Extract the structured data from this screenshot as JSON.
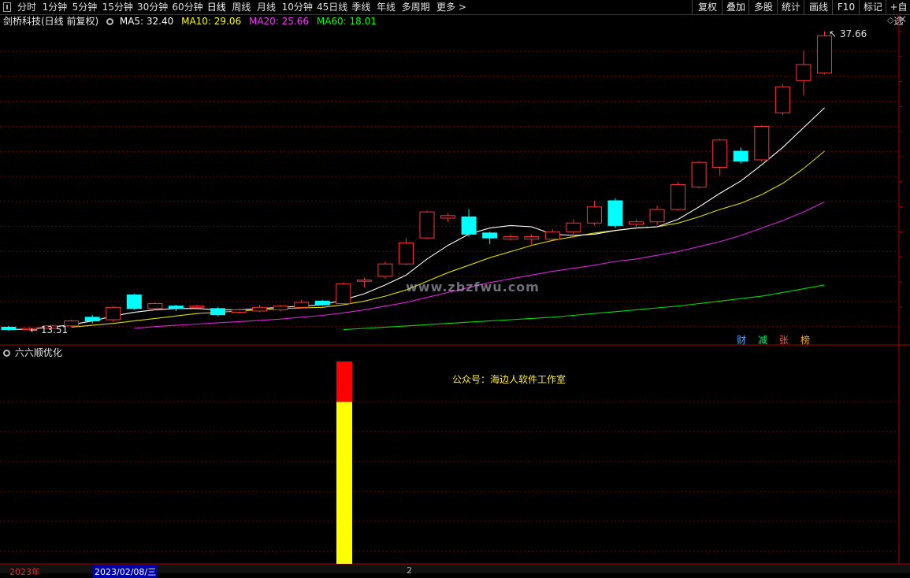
{
  "toolbar": {
    "periods": [
      "分时",
      "1分钟",
      "5分钟",
      "15分钟",
      "30分钟",
      "60分钟",
      "日线",
      "周线",
      "月线",
      "10分钟",
      "45日线",
      "季线",
      "年线",
      "多周期",
      "更多 >"
    ],
    "active_period": "日线",
    "right_buttons": [
      "复权",
      "叠加",
      "多股",
      "统计",
      "画线",
      "F10",
      "标记",
      "+自选"
    ]
  },
  "main_chart": {
    "stock_name": "剑桥科技(日线 前复权)",
    "ma": [
      {
        "label": "MA5: 32.40",
        "color": "#ffffff"
      },
      {
        "label": "MA10: 29.06",
        "color": "#ffff00"
      },
      {
        "label": "MA20: 25.66",
        "color": "#ff33ff"
      },
      {
        "label": "MA60: 18.01",
        "color": "#00ff00"
      }
    ],
    "high_label": "37.66",
    "low_label": "13.51",
    "watermark": "www.zbzfwu.com",
    "right_axis_label": "37",
    "badges": [
      {
        "text": "财",
        "color": "#55aaff"
      },
      {
        "text": "减",
        "color": "#00ff66"
      },
      {
        "text": "张",
        "color": "#ff5555"
      },
      {
        "text": "榜",
        "color": "#ffaa33"
      }
    ]
  },
  "indicator": {
    "name": "六六顺优化",
    "note": "公众号：海边人软件工作室",
    "bar": {
      "red_fraction": 0.2
    }
  },
  "footer": {
    "year_label": "2023年",
    "date_label": "2023/02/08/三",
    "marker": "2"
  },
  "chart_data": {
    "type": "candlestick",
    "price_range": [
      13.51,
      37.66
    ],
    "candles": [
      {
        "o": 13.8,
        "c": 13.6,
        "h": 13.9,
        "l": 13.5
      },
      {
        "o": 13.6,
        "c": 13.7,
        "h": 13.8,
        "l": 13.5
      },
      {
        "o": 13.7,
        "c": 13.9,
        "h": 14.0,
        "l": 13.6
      },
      {
        "o": 13.9,
        "c": 14.3,
        "h": 14.4,
        "l": 13.8
      },
      {
        "o": 14.6,
        "c": 14.3,
        "h": 14.8,
        "l": 14.1
      },
      {
        "o": 14.4,
        "c": 15.4,
        "h": 15.5,
        "l": 14.2
      },
      {
        "o": 16.4,
        "c": 15.3,
        "h": 16.5,
        "l": 15.2
      },
      {
        "o": 15.3,
        "c": 15.7,
        "h": 15.8,
        "l": 15.2
      },
      {
        "o": 15.5,
        "c": 15.3,
        "h": 15.6,
        "l": 15.1
      },
      {
        "o": 15.4,
        "c": 15.5,
        "h": 15.6,
        "l": 15.3
      },
      {
        "o": 15.3,
        "c": 14.8,
        "h": 15.4,
        "l": 14.7
      },
      {
        "o": 15.0,
        "c": 15.2,
        "h": 15.3,
        "l": 14.9
      },
      {
        "o": 15.1,
        "c": 15.4,
        "h": 15.6,
        "l": 15.0
      },
      {
        "o": 15.2,
        "c": 15.5,
        "h": 15.6,
        "l": 15.1
      },
      {
        "o": 15.4,
        "c": 15.8,
        "h": 16.0,
        "l": 15.3
      },
      {
        "o": 15.9,
        "c": 15.6,
        "h": 16.0,
        "l": 15.5
      },
      {
        "o": 15.7,
        "c": 17.3,
        "h": 17.4,
        "l": 15.6
      },
      {
        "o": 17.5,
        "c": 17.6,
        "h": 17.8,
        "l": 17.0
      },
      {
        "o": 17.9,
        "c": 18.9,
        "h": 19.1,
        "l": 17.7
      },
      {
        "o": 18.9,
        "c": 20.6,
        "h": 21.0,
        "l": 18.8
      },
      {
        "o": 21.0,
        "c": 23.1,
        "h": 23.2,
        "l": 20.9
      },
      {
        "o": 22.6,
        "c": 22.8,
        "h": 23.0,
        "l": 22.3
      },
      {
        "o": 22.7,
        "c": 21.3,
        "h": 23.3,
        "l": 21.1
      },
      {
        "o": 21.4,
        "c": 21.0,
        "h": 21.5,
        "l": 20.5
      },
      {
        "o": 20.9,
        "c": 21.1,
        "h": 21.3,
        "l": 20.8
      },
      {
        "o": 20.9,
        "c": 21.1,
        "h": 21.3,
        "l": 20.4
      },
      {
        "o": 20.9,
        "c": 21.5,
        "h": 21.7,
        "l": 20.8
      },
      {
        "o": 21.5,
        "c": 22.2,
        "h": 22.5,
        "l": 21.0
      },
      {
        "o": 22.2,
        "c": 23.5,
        "h": 24.0,
        "l": 22.0
      },
      {
        "o": 24.0,
        "c": 22.0,
        "h": 24.2,
        "l": 21.8
      },
      {
        "o": 22.1,
        "c": 22.3,
        "h": 22.5,
        "l": 21.9
      },
      {
        "o": 22.3,
        "c": 23.3,
        "h": 23.6,
        "l": 22.0
      },
      {
        "o": 23.3,
        "c": 25.3,
        "h": 25.5,
        "l": 23.2
      },
      {
        "o": 25.1,
        "c": 27.1,
        "h": 27.2,
        "l": 25.0
      },
      {
        "o": 26.7,
        "c": 28.9,
        "h": 29.0,
        "l": 26.0
      },
      {
        "o": 28.0,
        "c": 27.2,
        "h": 28.3,
        "l": 27.0
      },
      {
        "o": 27.3,
        "c": 30.0,
        "h": 30.1,
        "l": 27.1
      },
      {
        "o": 31.1,
        "c": 33.2,
        "h": 33.4,
        "l": 30.9
      },
      {
        "o": 33.7,
        "c": 35.0,
        "h": 36.1,
        "l": 32.5
      },
      {
        "o": 34.3,
        "c": 37.3,
        "h": 37.66,
        "l": 34.2
      }
    ],
    "ma5": [
      13.6,
      13.65,
      13.8,
      14.0,
      14.3,
      14.7,
      15.0,
      15.2,
      15.3,
      15.3,
      15.2,
      15.2,
      15.3,
      15.4,
      15.5,
      15.6,
      16.0,
      16.5,
      17.2,
      18.0,
      19.3,
      20.4,
      21.3,
      21.8,
      22.0,
      21.9,
      21.3,
      21.2,
      21.3,
      21.6,
      21.8,
      21.9,
      22.5,
      23.5,
      24.6,
      25.6,
      26.9,
      28.3,
      29.9,
      31.5
    ],
    "ma10": [
      null,
      null,
      null,
      13.8,
      13.95,
      14.1,
      14.3,
      14.5,
      14.7,
      14.9,
      15.0,
      15.1,
      15.2,
      15.3,
      15.35,
      15.4,
      15.6,
      15.9,
      16.3,
      16.8,
      17.5,
      18.2,
      18.8,
      19.4,
      19.9,
      20.4,
      20.8,
      21.1,
      21.4,
      21.6,
      21.8,
      21.9,
      22.2,
      22.7,
      23.3,
      23.8,
      24.5,
      25.4,
      26.6,
      28.0
    ],
    "ma20": [
      null,
      null,
      null,
      null,
      null,
      null,
      13.7,
      13.85,
      13.95,
      14.05,
      14.15,
      14.25,
      14.35,
      14.45,
      14.6,
      14.75,
      14.95,
      15.2,
      15.5,
      15.8,
      16.2,
      16.6,
      17.0,
      17.4,
      17.7,
      18.0,
      18.3,
      18.55,
      18.8,
      19.1,
      19.3,
      19.6,
      19.9,
      20.3,
      20.7,
      21.2,
      21.8,
      22.4,
      23.1,
      23.9
    ],
    "ma60": [
      null,
      null,
      null,
      null,
      null,
      null,
      null,
      null,
      null,
      null,
      null,
      null,
      null,
      null,
      null,
      null,
      13.6,
      13.7,
      13.8,
      13.9,
      14.0,
      14.1,
      14.2,
      14.3,
      14.4,
      14.5,
      14.6,
      14.75,
      14.9,
      15.05,
      15.2,
      15.35,
      15.5,
      15.7,
      15.9,
      16.1,
      16.3,
      16.6,
      16.9,
      17.2
    ]
  }
}
